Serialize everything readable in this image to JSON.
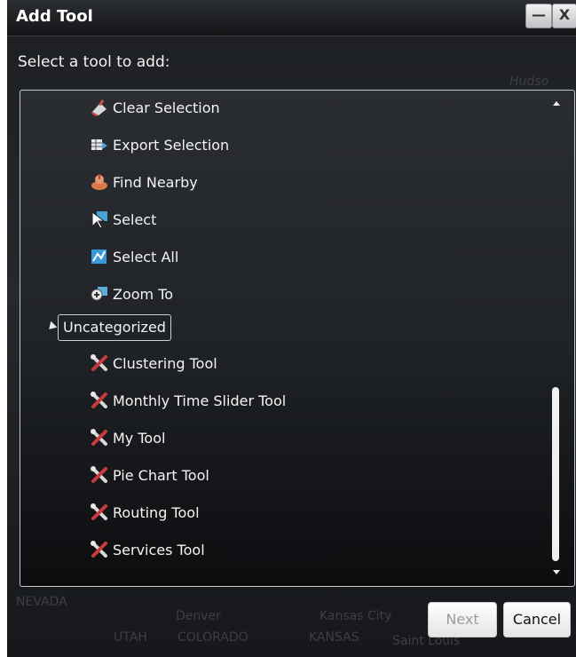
{
  "window": {
    "title": "Add Tool",
    "minimize_glyph": "—",
    "close_glyph": "X"
  },
  "prompt": "Select a tool to add:",
  "tools_top": [
    {
      "label": "Clear Selection",
      "icon": "clear-selection-icon"
    },
    {
      "label": "Export Selection",
      "icon": "export-selection-icon"
    },
    {
      "label": "Find Nearby",
      "icon": "find-nearby-icon"
    },
    {
      "label": "Select",
      "icon": "select-icon"
    },
    {
      "label": "Select All",
      "icon": "select-all-icon"
    },
    {
      "label": "Zoom To",
      "icon": "zoom-to-icon"
    }
  ],
  "category": {
    "label": "Uncategorized",
    "expanded": true
  },
  "tools_uncategorized": [
    {
      "label": "Clustering Tool",
      "icon": "wrench-tool-icon"
    },
    {
      "label": "Monthly Time Slider Tool",
      "icon": "wrench-tool-icon"
    },
    {
      "label": "My Tool",
      "icon": "wrench-tool-icon"
    },
    {
      "label": "Pie Chart Tool",
      "icon": "wrench-tool-icon"
    },
    {
      "label": "Routing Tool",
      "icon": "wrench-tool-icon"
    },
    {
      "label": "Services Tool",
      "icon": "wrench-tool-icon"
    }
  ],
  "map_labels": {
    "a": "NEVADA",
    "b": "Denver",
    "c": "COLORADO",
    "d": "Kansas City",
    "e": "KANSAS",
    "f": "Saint Louis",
    "g": "UTAH",
    "h": "Hudso"
  },
  "buttons": {
    "next": "Next",
    "cancel": "Cancel"
  },
  "colors": {
    "dialog_bg": "#1d1f22",
    "text": "#f4f4f4",
    "button_bg": "#ffffff",
    "disabled_text": "#9b9b9b"
  }
}
